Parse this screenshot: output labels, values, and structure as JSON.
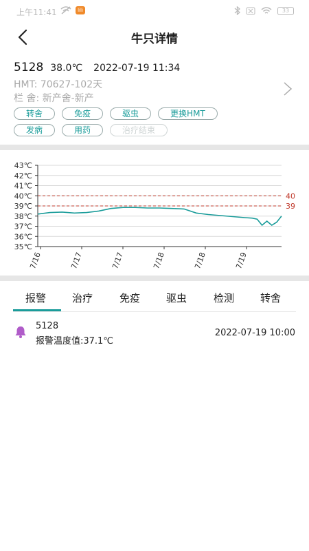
{
  "status_bar": {
    "time": "上午11:41",
    "app_badge": "lili",
    "battery": "33"
  },
  "header": {
    "title": "牛只详情"
  },
  "cow": {
    "id": "5128",
    "temperature": "38.0℃",
    "timestamp": "2022-07-19 11:34",
    "hmt": "HMT: 70627-102天",
    "pen": "栏 舍: 新产舍-新产"
  },
  "actions": {
    "row1": [
      "转舍",
      "免疫",
      "驱虫",
      "更换HMT"
    ],
    "row2": [
      "发病",
      "用药"
    ],
    "disabled": "治疗结束"
  },
  "chart_data": {
    "type": "line",
    "y_tick_labels": [
      "43℃",
      "42℃",
      "41℃",
      "40℃",
      "39℃",
      "38℃",
      "37℃",
      "36℃",
      "35℃"
    ],
    "ylim": [
      35,
      43
    ],
    "x_tick_labels": [
      "7/16",
      "7/17",
      "7/17",
      "7/18",
      "7/18",
      "7/19"
    ],
    "thresholds": [
      {
        "label": "40",
        "value": 40
      },
      {
        "label": "39",
        "value": 39
      }
    ],
    "series": [
      {
        "x": [
          0,
          0.05,
          0.1,
          0.15,
          0.2,
          0.25,
          0.3,
          0.35,
          0.4,
          0.45,
          0.5,
          0.55,
          0.6,
          0.65,
          0.7,
          0.75,
          0.8,
          0.85,
          0.88,
          0.9,
          0.92,
          0.94,
          0.96,
          0.98,
          1.0
        ],
        "y": [
          38.2,
          38.35,
          38.4,
          38.3,
          38.35,
          38.5,
          38.75,
          38.85,
          38.85,
          38.8,
          38.8,
          38.75,
          38.7,
          38.3,
          38.15,
          38.05,
          37.95,
          37.85,
          37.8,
          37.7,
          37.1,
          37.5,
          37.1,
          37.4,
          38.0
        ]
      }
    ],
    "colors": {
      "line": "#1a9c9a",
      "threshold": "#c0392b",
      "grid": "#d8d8d8"
    }
  },
  "tabs": [
    "报警",
    "治疗",
    "免疫",
    "驱虫",
    "检测",
    "转舍"
  ],
  "active_tab": 0,
  "alarms": [
    {
      "id": "5128",
      "desc": "报警温度值:37.1℃",
      "time": "2022-07-19 10:00"
    }
  ],
  "colors": {
    "accent": "#1a9c9a",
    "bell": "#b05cc9"
  }
}
